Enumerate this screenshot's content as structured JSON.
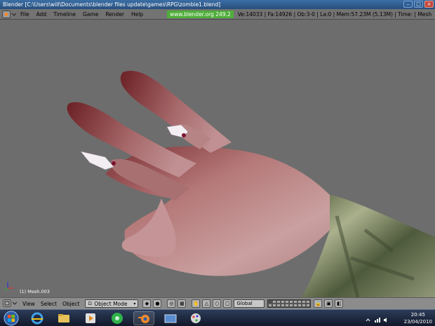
{
  "window": {
    "title": "Blender [C:\\Users\\will\\Documents\\blender files update\\games\\RPG\\zombie1.blend]"
  },
  "menubar": {
    "items": [
      "File",
      "Add",
      "Timeline",
      "Game",
      "Render",
      "Help"
    ],
    "url": "www.blender.org 249.2",
    "stats": "Ve:14033 | Fa:14926 | Ob:3-0 | La:0  | Mem:57.23M (5.13M)  | Time: | Mesh"
  },
  "viewport": {
    "object_label": "(1) Mesh.003",
    "background_color": "#6d6d6d"
  },
  "header3d": {
    "menus": [
      "View",
      "Select",
      "Object"
    ],
    "mode": "Object Mode",
    "orientation": "Global"
  },
  "taskbar": {
    "clock_time": "20:45",
    "clock_date": "23/04/2010"
  },
  "colors": {
    "titlebar": "#3b6ea5",
    "url_badge": "#4fae3a",
    "menubar": "#737373"
  }
}
